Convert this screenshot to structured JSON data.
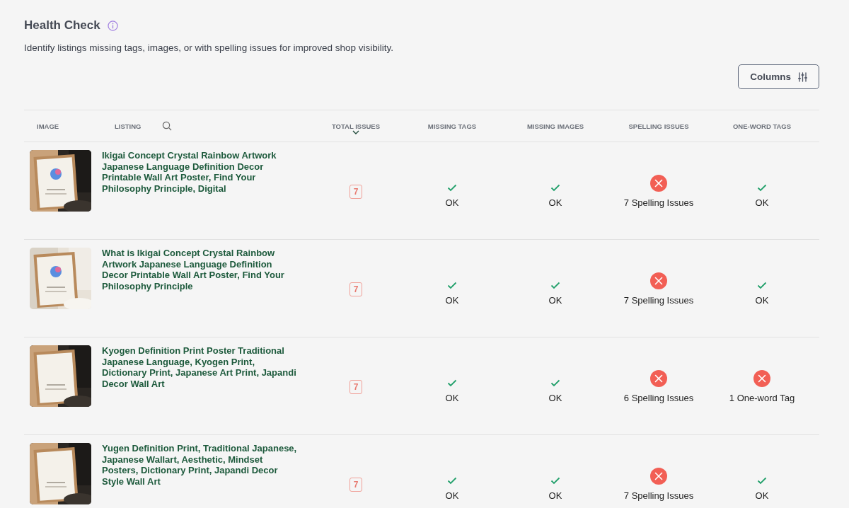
{
  "page": {
    "title": "Health Check",
    "description": "Identify listings missing tags, images, or with spelling issues for improved shop visibility."
  },
  "columns_button": {
    "label": "Columns"
  },
  "table": {
    "columns": [
      "IMAGE",
      "LISTING",
      "TOTAL ISSUES",
      "MISSING TAGS",
      "MISSING IMAGES",
      "SPELLING ISSUES",
      "ONE-WORD TAGS"
    ],
    "rows": [
      {
        "listing": "Ikigai Concept Crystal Rainbow Artwork Japanese Language Definition Decor Printable Wall Art Poster, Find Your Philosophy Principle, Digital",
        "total_issues": "7",
        "checks": [
          {
            "ok": true,
            "text": "OK"
          },
          {
            "ok": true,
            "text": "OK"
          },
          {
            "ok": false,
            "text": "7 Spelling Issues"
          },
          {
            "ok": true,
            "text": "OK"
          }
        ]
      },
      {
        "listing": "What is Ikigai Concept Crystal Rainbow Artwork Japanese Language Definition Decor Printable Wall Art Poster, Find Your Philosophy Principle",
        "total_issues": "7",
        "checks": [
          {
            "ok": true,
            "text": "OK"
          },
          {
            "ok": true,
            "text": "OK"
          },
          {
            "ok": false,
            "text": "7 Spelling Issues"
          },
          {
            "ok": true,
            "text": "OK"
          }
        ]
      },
      {
        "listing": "Kyogen Definition Print Poster Traditional Japanese Language, Kyogen Print, Dictionary Print, Japanese Art Print, Japandi Decor Wall Art",
        "total_issues": "7",
        "checks": [
          {
            "ok": true,
            "text": "OK"
          },
          {
            "ok": true,
            "text": "OK"
          },
          {
            "ok": false,
            "text": "6 Spelling Issues"
          },
          {
            "ok": false,
            "text": "1 One-word Tag"
          }
        ]
      },
      {
        "listing": "Yugen Definition Print, Traditional Japanese, Japanese Wallart, Aesthetic, Mindset Posters, Dictionary Print, Japandi Decor Style Wall Art",
        "total_issues": "7",
        "checks": [
          {
            "ok": true,
            "text": "OK"
          },
          {
            "ok": true,
            "text": "OK"
          },
          {
            "ok": false,
            "text": "7 Spelling Issues"
          },
          {
            "ok": true,
            "text": "OK"
          }
        ]
      }
    ]
  }
}
